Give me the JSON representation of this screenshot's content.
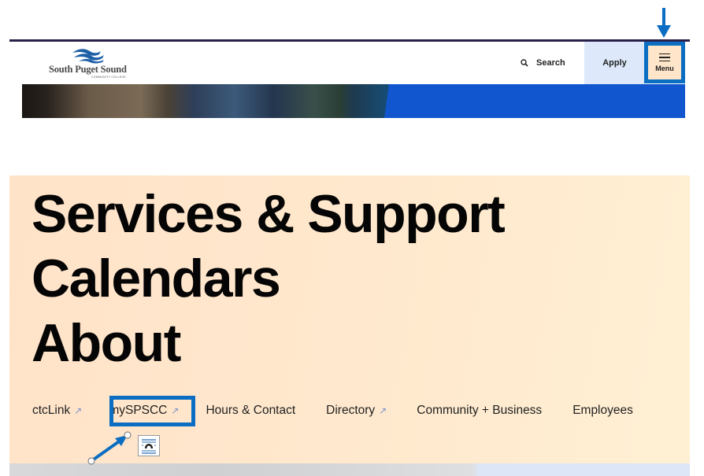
{
  "header": {
    "logo": {
      "name": "South Puget Sound",
      "subtitle": "COMMUNITY COLLEGE"
    },
    "search_label": "Search",
    "apply_label": "Apply",
    "menu_label": "Menu"
  },
  "menu_panel": {
    "primary_links": [
      {
        "label": "Services & Support"
      },
      {
        "label": "Calendars"
      },
      {
        "label": "About"
      }
    ],
    "secondary_links": [
      {
        "label": "ctcLink",
        "external": true
      },
      {
        "label": "mySPSCC",
        "external": true
      },
      {
        "label": "Hours & Contact",
        "external": false
      },
      {
        "label": "Directory",
        "external": true
      },
      {
        "label": "Community + Business",
        "external": false
      },
      {
        "label": "Employees",
        "external": false
      }
    ],
    "external_glyph": "↗"
  },
  "annotations": {
    "highlight_color": "#0b6ec2",
    "highlighted": [
      "menu-button",
      "sub-nav-myspscc"
    ]
  },
  "colors": {
    "brand_dark": "#2a1f4a",
    "apply_bg": "#dde9fb",
    "menu_bg": "#ffe5c9",
    "hero_blue": "#1156cf",
    "panel_bg": "#ffe6cc"
  }
}
